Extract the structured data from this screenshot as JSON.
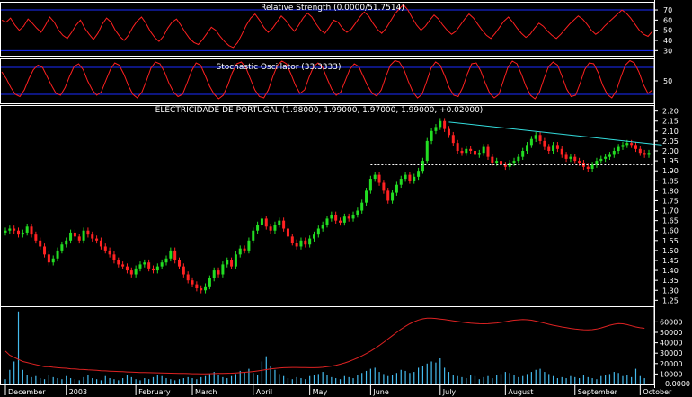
{
  "colors": {
    "background": "#000000",
    "frame": "#ffffff",
    "guide": "#1a2cff",
    "indicator": "#ff2020",
    "candle_up": "#22dd22",
    "candle_down": "#ff2222",
    "trendline": "#33dddd",
    "volume": "#44bbee",
    "volume_ma": "#dd2222"
  },
  "corner_label": "0.0000",
  "rsi": {
    "title": "Relative Strength (0.0000/51.7514)",
    "ylim": [
      25,
      78
    ],
    "ticks": [
      30,
      40,
      50,
      60,
      70
    ],
    "tick_labels": [
      "30",
      "40",
      "50",
      "60",
      "70"
    ],
    "guides": [
      30,
      70
    ],
    "values": [
      60,
      58,
      62,
      55,
      50,
      54,
      61,
      57,
      52,
      48,
      55,
      63,
      58,
      50,
      45,
      42,
      48,
      55,
      60,
      52,
      46,
      41,
      47,
      56,
      62,
      58,
      50,
      44,
      40,
      45,
      53,
      59,
      63,
      57,
      49,
      43,
      39,
      44,
      52,
      58,
      61,
      55,
      48,
      42,
      38,
      36,
      41,
      47,
      53,
      50,
      44,
      39,
      35,
      33,
      38,
      46,
      55,
      62,
      66,
      60,
      53,
      48,
      52,
      58,
      64,
      60,
      54,
      49,
      55,
      62,
      67,
      63,
      56,
      50,
      47,
      53,
      60,
      58,
      52,
      48,
      51,
      57,
      63,
      68,
      64,
      57,
      51,
      47,
      52,
      59,
      66,
      71,
      75,
      70,
      62,
      55,
      50,
      54,
      60,
      65,
      61,
      55,
      50,
      46,
      49,
      55,
      61,
      66,
      62,
      56,
      50,
      45,
      42,
      47,
      53,
      59,
      63,
      58,
      52,
      47,
      43,
      46,
      52,
      57,
      54,
      49,
      45,
      42,
      46,
      51,
      56,
      60,
      64,
      61,
      56,
      50,
      46,
      49,
      54,
      58,
      62,
      66,
      70,
      67,
      62,
      56,
      50,
      46,
      44,
      49
    ]
  },
  "stochastic": {
    "title": "Stochastic Oscillator (33.3333)",
    "ylim": [
      0,
      100
    ],
    "ticks": [
      50
    ],
    "tick_labels": [
      "50"
    ],
    "guides": [
      20,
      80
    ],
    "values": [
      70,
      55,
      35,
      20,
      15,
      30,
      55,
      75,
      85,
      80,
      60,
      40,
      22,
      18,
      35,
      60,
      82,
      88,
      75,
      50,
      30,
      18,
      25,
      50,
      75,
      90,
      85,
      65,
      40,
      20,
      12,
      25,
      50,
      78,
      92,
      88,
      70,
      45,
      25,
      15,
      20,
      45,
      72,
      90,
      85,
      62,
      38,
      20,
      10,
      18,
      40,
      68,
      88,
      92,
      80,
      55,
      30,
      15,
      12,
      30,
      60,
      85,
      94,
      88,
      65,
      40,
      22,
      30,
      58,
      82,
      90,
      80,
      55,
      32,
      18,
      25,
      50,
      75,
      88,
      82,
      60,
      38,
      22,
      16,
      30,
      60,
      85,
      95,
      92,
      75,
      48,
      25,
      12,
      20,
      48,
      78,
      92,
      85,
      62,
      35,
      18,
      15,
      35,
      65,
      88,
      90,
      72,
      45,
      22,
      12,
      20,
      50,
      80,
      94,
      88,
      65,
      38,
      18,
      10,
      25,
      55,
      82,
      92,
      85,
      60,
      32,
      15,
      18,
      45,
      75,
      90,
      88,
      68,
      40,
      20,
      12,
      28,
      58,
      85,
      95,
      90,
      70,
      42,
      22,
      30
    ]
  },
  "price": {
    "title": "ELECTRICIDADE DE PORTUGAL (1.98000, 1.99000, 1.97000, 1.99000, +0.02000)",
    "ylim": [
      1.22,
      2.23
    ],
    "ticks": [
      1.25,
      1.3,
      1.35,
      1.4,
      1.45,
      1.5,
      1.55,
      1.6,
      1.65,
      1.7,
      1.75,
      1.8,
      1.85,
      1.9,
      1.95,
      2.0,
      2.05,
      2.1,
      2.15,
      2.2
    ],
    "tick_labels": [
      "1.25",
      "1.30",
      "1.35",
      "1.40",
      "1.45",
      "1.50",
      "1.55",
      "1.60",
      "1.65",
      "1.70",
      "1.75",
      "1.80",
      "1.85",
      "1.90",
      "1.95",
      "2.00",
      "2.05",
      "2.10",
      "2.15",
      "2.20"
    ],
    "closes": [
      1.6,
      1.61,
      1.6,
      1.58,
      1.59,
      1.62,
      1.58,
      1.55,
      1.52,
      1.48,
      1.44,
      1.46,
      1.5,
      1.53,
      1.55,
      1.59,
      1.57,
      1.55,
      1.6,
      1.58,
      1.56,
      1.55,
      1.52,
      1.5,
      1.48,
      1.45,
      1.43,
      1.42,
      1.4,
      1.38,
      1.41,
      1.43,
      1.44,
      1.41,
      1.4,
      1.42,
      1.44,
      1.46,
      1.5,
      1.45,
      1.42,
      1.38,
      1.35,
      1.33,
      1.31,
      1.3,
      1.32,
      1.36,
      1.4,
      1.38,
      1.43,
      1.45,
      1.42,
      1.48,
      1.51,
      1.5,
      1.55,
      1.6,
      1.63,
      1.66,
      1.62,
      1.6,
      1.63,
      1.65,
      1.61,
      1.57,
      1.54,
      1.52,
      1.55,
      1.53,
      1.56,
      1.58,
      1.61,
      1.63,
      1.66,
      1.68,
      1.65,
      1.64,
      1.67,
      1.66,
      1.68,
      1.7,
      1.74,
      1.8,
      1.86,
      1.88,
      1.84,
      1.8,
      1.75,
      1.79,
      1.83,
      1.86,
      1.88,
      1.85,
      1.87,
      1.9,
      1.95,
      2.05,
      2.1,
      2.12,
      2.15,
      2.11,
      2.08,
      2.04,
      2.0,
      1.99,
      2.01,
      2.0,
      1.98,
      1.99,
      2.02,
      1.97,
      1.94,
      1.95,
      1.93,
      1.92,
      1.94,
      1.95,
      1.97,
      2.0,
      2.03,
      2.06,
      2.08,
      2.05,
      2.02,
      2.0,
      2.03,
      2.01,
      1.98,
      1.96,
      1.97,
      1.95,
      1.94,
      1.92,
      1.91,
      1.93,
      1.95,
      1.96,
      1.97,
      1.98,
      2.0,
      2.02,
      2.03,
      2.04,
      2.03,
      2.01,
      1.99,
      1.98,
      1.99
    ],
    "resistance": {
      "from_index": 102,
      "from_value": 2.145,
      "to_index": 151,
      "to_value": 2.03
    },
    "support": {
      "from_index": 84,
      "to_index": 153,
      "value": 1.93
    }
  },
  "volume": {
    "ylim": [
      0,
      75000
    ],
    "ticks": [
      10000,
      20000,
      30000,
      40000,
      50000,
      60000
    ],
    "tick_labels": [
      "10000",
      "20000",
      "30000",
      "40000",
      "50000",
      "60000"
    ],
    "values": [
      5000,
      14000,
      22000,
      70000,
      14000,
      9000,
      7000,
      8000,
      6000,
      5000,
      9000,
      7000,
      6000,
      5000,
      8000,
      6000,
      5000,
      4000,
      7000,
      9000,
      6000,
      5000,
      4000,
      8000,
      6000,
      5000,
      4000,
      6000,
      9000,
      7000,
      5000,
      4000,
      6000,
      5000,
      7000,
      9000,
      8000,
      6000,
      5000,
      4000,
      5000,
      6000,
      7000,
      6000,
      5000,
      7000,
      8000,
      10000,
      12000,
      9000,
      7000,
      6000,
      8000,
      10000,
      13000,
      12000,
      15000,
      11000,
      9000,
      22000,
      27000,
      18000,
      14000,
      10000,
      8000,
      6000,
      5000,
      7000,
      6000,
      5000,
      8000,
      9000,
      10000,
      12000,
      9000,
      7000,
      6000,
      5000,
      8000,
      7000,
      6000,
      9000,
      11000,
      13000,
      15000,
      16000,
      12000,
      10000,
      8000,
      9000,
      11000,
      14000,
      13000,
      11000,
      12000,
      16000,
      18000,
      20000,
      22000,
      21000,
      25000,
      16000,
      12000,
      9000,
      8000,
      7000,
      6000,
      9000,
      8000,
      5000,
      7000,
      8000,
      6000,
      9000,
      10000,
      12000,
      11000,
      9000,
      7000,
      8000,
      10000,
      12000,
      14000,
      15000,
      12000,
      10000,
      8000,
      6000,
      7000,
      6000,
      8000,
      7000,
      6000,
      9000,
      7000,
      6000,
      5000,
      8000,
      9000,
      10000,
      12000,
      11000,
      8000,
      9000,
      7000,
      15000,
      8000,
      6000
    ],
    "ma": [
      32000,
      28000,
      26000,
      24000,
      22000,
      21000,
      20000,
      19000,
      18000,
      17000,
      17000,
      16500,
      16000,
      15800,
      15500,
      15000,
      14800,
      14500,
      14300,
      14000,
      13800,
      13500,
      13200,
      13000,
      12800,
      12600,
      12400,
      12200,
      12000,
      11800,
      11600,
      11500,
      11400,
      11300,
      11200,
      11100,
      11000,
      10900,
      10800,
      10700,
      10600,
      10500,
      10400,
      10300,
      10300,
      10200,
      10200,
      10300,
      10400,
      10500,
      10600,
      10700,
      10800,
      11000,
      11300,
      11600,
      12000,
      12400,
      12900,
      13500,
      14200,
      14800,
      15300,
      15700,
      16000,
      16200,
      16300,
      16300,
      16200,
      16100,
      16000,
      16000,
      16200,
      16500,
      17000,
      17600,
      18400,
      19400,
      20600,
      22000,
      23600,
      25400,
      27400,
      29600,
      32000,
      34600,
      37400,
      40400,
      43600,
      46800,
      50000,
      53000,
      55800,
      58200,
      60200,
      61800,
      62900,
      63500,
      63600,
      63300,
      62800,
      62200,
      61600,
      61000,
      60400,
      59800,
      59200,
      58800,
      58500,
      58300,
      58200,
      58300,
      58600,
      59000,
      59600,
      60300,
      61000,
      61600,
      62000,
      62200,
      62100,
      61600,
      60800,
      59800,
      58800,
      57800,
      56800,
      56000,
      55200,
      54500,
      53800,
      53200,
      52800,
      52500,
      52400,
      52600,
      53200,
      54200,
      55500,
      56800,
      57800,
      58400,
      58200,
      57400,
      56300,
      55200,
      54400,
      53900
    ]
  },
  "months": [
    "December",
    "2003",
    "February",
    "March",
    "April",
    "May",
    "June",
    "July",
    "August",
    "September",
    "October"
  ],
  "month_positions": [
    0,
    14,
    30,
    43,
    57,
    70,
    84,
    100,
    115,
    131,
    146
  ]
}
